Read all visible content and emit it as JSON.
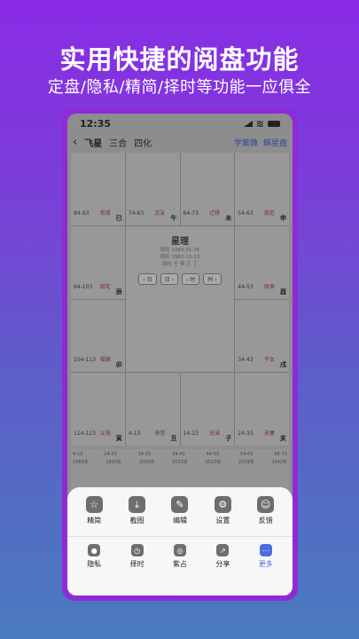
{
  "promo": {
    "headline": "实用快捷的阅盘功能",
    "subline": "定盘/隐私/精简/择时等功能一应俱全"
  },
  "statusbar": {
    "time": "12:35"
  },
  "nav": {
    "back_label": "‹",
    "tabs": [
      "飞星",
      "三合",
      "四化"
    ],
    "right_links": [
      "学紫微",
      "解星盘"
    ]
  },
  "chart": {
    "palaces": [
      {
        "branch": "巳",
        "name": "官禄",
        "range": "84-93"
      },
      {
        "branch": "午",
        "name": "交友",
        "range": "74-83"
      },
      {
        "branch": "未",
        "name": "迁移",
        "range": "64-73"
      },
      {
        "branch": "申",
        "name": "疾厄",
        "range": "54-63"
      },
      {
        "branch": "辰",
        "name": "田宅",
        "range": "94-103"
      },
      {
        "branch": "酉",
        "name": "财帛",
        "range": "44-53"
      },
      {
        "branch": "卯",
        "name": "福德",
        "range": "104-113"
      },
      {
        "branch": "戌",
        "name": "子女",
        "range": "34-43"
      },
      {
        "branch": "寅",
        "name": "父母",
        "range": "114-123"
      },
      {
        "branch": "丑",
        "name": "命宫",
        "range": "4-13"
      },
      {
        "branch": "子",
        "name": "兄弟",
        "range": "14-23"
      },
      {
        "branch": "亥",
        "name": "夫妻",
        "range": "24-33"
      }
    ],
    "center_title": "星理",
    "center_lines": [
      "阳历 1983-01-26",
      "阴历 1982-12-13",
      "四柱 壬 癸 乙 丁"
    ],
    "center_buttons": [
      "‹ 日",
      "日 ›",
      "‹ 时",
      "时 ›"
    ]
  },
  "timeline": {
    "rows": [
      [
        "4-13",
        "14-23",
        "24-33",
        "34-43",
        "44-53",
        "54-63",
        "64-73"
      ],
      [
        "1983年",
        "1993年",
        "2003年",
        "2013年",
        "2023年",
        "2033年",
        "2043年"
      ]
    ]
  },
  "toolbar": {
    "row1": [
      {
        "icon": "☆",
        "label": "精简"
      },
      {
        "icon": "⤓",
        "label": "截图"
      },
      {
        "icon": "✎",
        "label": "编辑"
      },
      {
        "icon": "⚙",
        "label": "设置"
      },
      {
        "icon": "☺",
        "label": "反馈"
      }
    ],
    "row2": [
      {
        "icon": "●",
        "label": "隐私"
      },
      {
        "icon": "◷",
        "label": "择时"
      },
      {
        "icon": "◎",
        "label": "紫占"
      },
      {
        "icon": "↗",
        "label": "分享"
      },
      {
        "icon": "⋯",
        "label": "更多"
      }
    ]
  }
}
